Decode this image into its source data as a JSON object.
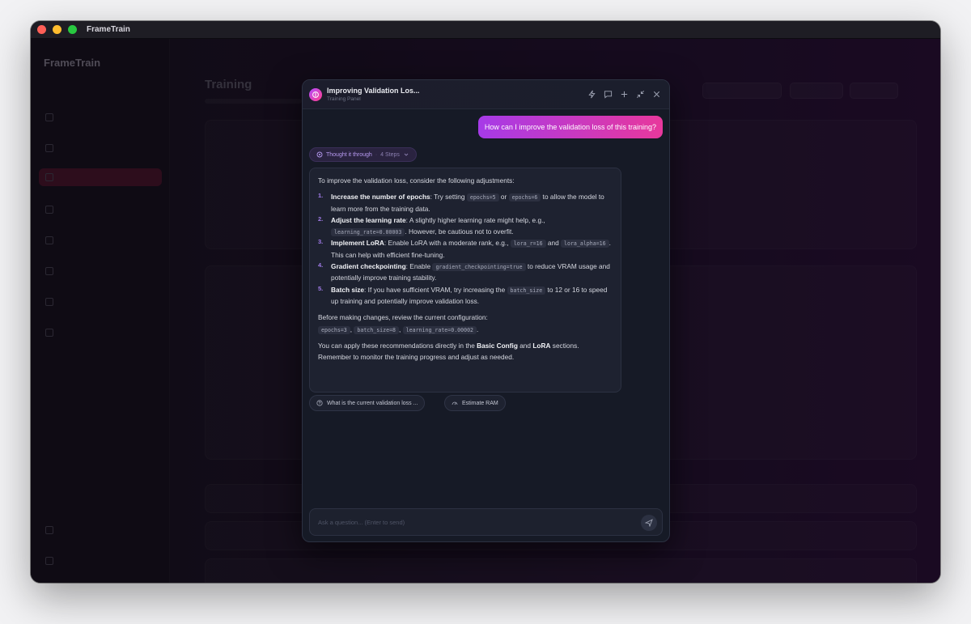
{
  "window": {
    "app_title": "FrameTrain"
  },
  "background": {
    "brand": "FrameTrain",
    "sidebar_items": [
      {
        "label": ""
      },
      {
        "label": ""
      },
      {
        "label": ""
      },
      {
        "label": ""
      },
      {
        "label": ""
      },
      {
        "label": ""
      },
      {
        "label": ""
      },
      {
        "label": ""
      }
    ],
    "page_title": "Training"
  },
  "panel": {
    "title": "Improving Validation Los...",
    "subtitle": "Training Panel",
    "tools": [
      "bolt-icon",
      "chat-icon",
      "plus-icon",
      "shrink-icon",
      "close-icon"
    ],
    "user_message": "How can I improve the validation loss of this training?",
    "thought": {
      "label": "Thought it through",
      "steps": "4 Steps"
    },
    "answer": {
      "intro": "To improve the validation loss, consider the following adjustments:",
      "items": [
        {
          "num": "1.",
          "title": "Increase the number of epochs",
          "a": ": Try setting ",
          "c1": "epochs=5",
          "b": " or ",
          "c2": "epochs=6",
          "c": " to allow the model to learn more from the training data."
        },
        {
          "num": "2.",
          "title": "Adjust the learning rate",
          "a": ": A slightly higher learning rate might help, e.g., ",
          "c1": "learning_rate=0.00003",
          "b": ". However, be cautious not to overfit."
        },
        {
          "num": "3.",
          "title": "Implement LoRA",
          "a": ": Enable LoRA with a moderate rank, e.g., ",
          "c1": "lora_r=16",
          "b": " and ",
          "c2": "lora_alpha=16",
          "c": ". This can help with efficient fine-tuning."
        },
        {
          "num": "4.",
          "title": "Gradient checkpointing",
          "a": ": Enable ",
          "c1": "gradient_checkpointing=true",
          "b": " to reduce VRAM usage and potentially improve training stability."
        },
        {
          "num": "5.",
          "title": "Batch size",
          "a": ": If you have sufficient VRAM, try increasing the ",
          "c1": "batch_size",
          "b": " to 12 or 16 to speed up training and potentially improve validation loss."
        }
      ],
      "review": "Before making changes, review the current configuration:",
      "config": [
        "epochs=3",
        "batch_size=8",
        "learning_rate=0.00002"
      ],
      "apply_a": "You can apply these recommendations directly in the ",
      "apply_b1": "Basic Config",
      "apply_and": " and ",
      "apply_b2": "LoRA",
      "apply_c": " sections.",
      "remember": "Remember to monitor the training progress and adjust as needed."
    },
    "suggestions": [
      {
        "label": "What is the current validation loss ...",
        "icon": "help-circle-icon"
      },
      {
        "label": "Estimate RAM",
        "icon": "gauge-icon"
      }
    ],
    "input": {
      "placeholder": "Ask a question... (Enter to send)",
      "value": ""
    }
  }
}
